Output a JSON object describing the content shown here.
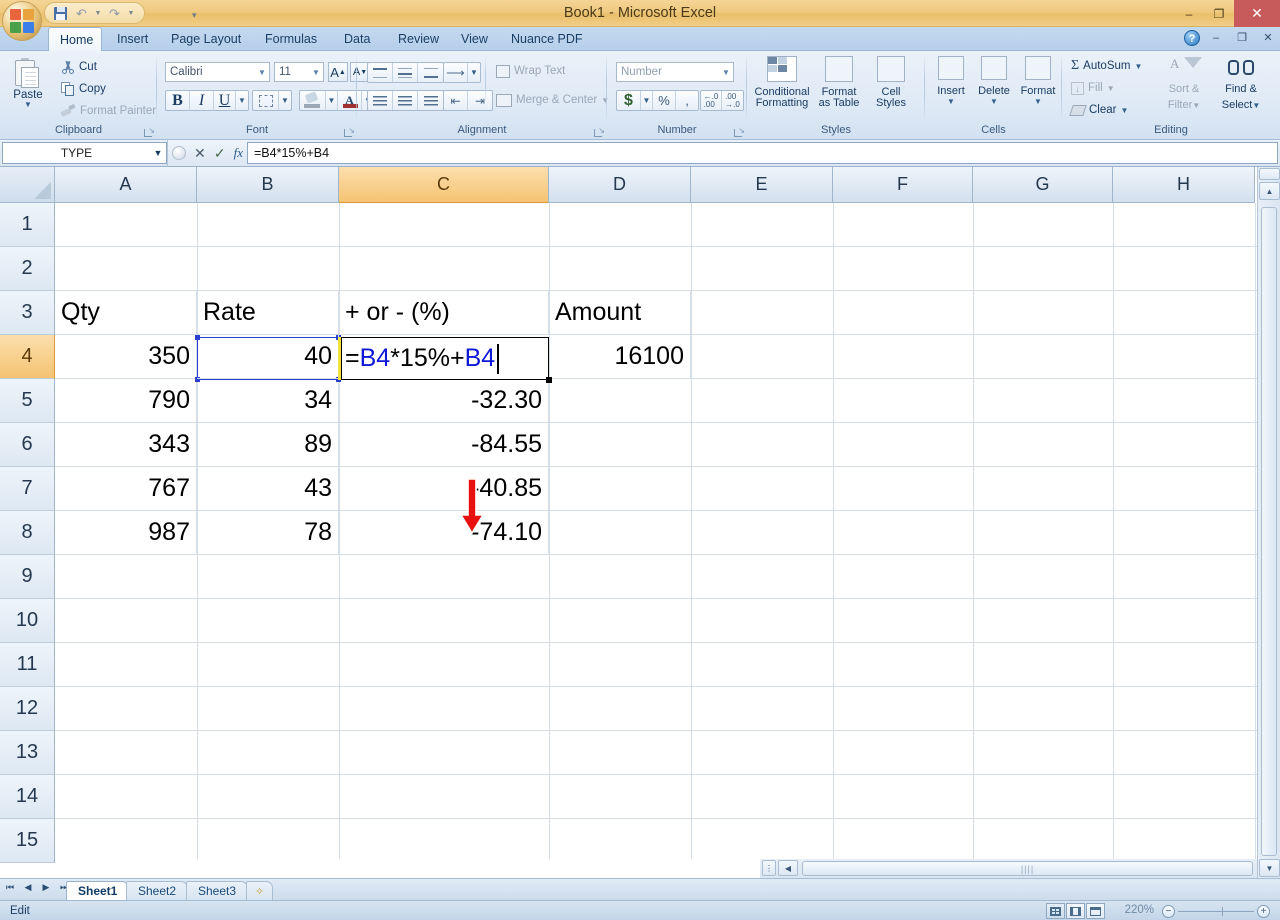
{
  "window": {
    "title": "Book1 - Microsoft Excel",
    "minimize": "–",
    "restore": "❐",
    "close": "✕"
  },
  "quick_access": {
    "save_icon": "save-icon",
    "undo_icon": "undo-icon",
    "redo_icon": "redo-icon",
    "customize_icon": "customize-qat-icon"
  },
  "workbook_controls": {
    "help": "?",
    "minimize": "–",
    "restore": "❐",
    "close": "✕"
  },
  "tabs": [
    {
      "label": "Home",
      "active": true
    },
    {
      "label": "Insert",
      "active": false
    },
    {
      "label": "Page Layout",
      "active": false
    },
    {
      "label": "Formulas",
      "active": false
    },
    {
      "label": "Data",
      "active": false
    },
    {
      "label": "Review",
      "active": false
    },
    {
      "label": "View",
      "active": false
    },
    {
      "label": "Nuance PDF",
      "active": false
    }
  ],
  "ribbon": {
    "clipboard": {
      "label": "Clipboard",
      "paste": "Paste",
      "cut": "Cut",
      "copy": "Copy",
      "format_painter": "Format Painter"
    },
    "font": {
      "label": "Font",
      "font_name": "Calibri",
      "font_size": "11",
      "grow_font": "A",
      "shrink_font": "A",
      "bold": "B",
      "italic": "I",
      "underline": "U"
    },
    "alignment": {
      "label": "Alignment",
      "wrap_text": "Wrap Text",
      "merge_center": "Merge & Center"
    },
    "number": {
      "label": "Number",
      "format": "Number",
      "currency": "$",
      "percent": "%",
      "comma": ",",
      "increase_decimal": ".00",
      "decrease_decimal": ".00"
    },
    "styles": {
      "label": "Styles",
      "conditional_formatting": "Conditional\nFormatting",
      "conditional_formatting_l1": "Conditional",
      "conditional_formatting_l2": "Formatting",
      "format_as_table_l1": "Format",
      "format_as_table_l2": "as Table",
      "cell_styles_l1": "Cell",
      "cell_styles_l2": "Styles"
    },
    "cells": {
      "label": "Cells",
      "insert": "Insert",
      "delete": "Delete",
      "format": "Format"
    },
    "editing": {
      "label": "Editing",
      "autosum": "AutoSum",
      "fill": "Fill",
      "clear": "Clear",
      "sort_filter_l1": "Sort &",
      "sort_filter_l2": "Filter",
      "find_select_l1": "Find &",
      "find_select_l2": "Select",
      "sigma": "Σ"
    }
  },
  "formula_bar": {
    "name_box": "TYPE",
    "cancel_icon": "cancel-icon",
    "enter_icon": "enter-icon",
    "insert_function_icon": "fx",
    "formula": "=B4*15%+B4"
  },
  "grid": {
    "columns": [
      "A",
      "B",
      "C",
      "D",
      "E",
      "F",
      "G",
      "H"
    ],
    "selected_column": "C",
    "rows": [
      "1",
      "2",
      "3",
      "4",
      "5",
      "6",
      "7",
      "8",
      "9",
      "10",
      "11",
      "12",
      "13",
      "14",
      "15"
    ],
    "selected_row": "4",
    "cells": {
      "A3": "Qty",
      "B3": "Rate",
      "C3": "+ or - (%)",
      "D3": "Amount",
      "A4": "350",
      "B4": "40",
      "D4": "16100",
      "A5": "790",
      "B5": "34",
      "C5": "-32.30",
      "A6": "343",
      "B6": "89",
      "C6": "-84.55",
      "A7": "767",
      "B7": "43",
      "C7": "-40.85",
      "A8": "987",
      "B8": "78",
      "C8": "-74.10"
    },
    "editing_cell": {
      "address": "C4",
      "parts": [
        {
          "text": "=",
          "kind": "op"
        },
        {
          "text": "B4",
          "kind": "ref"
        },
        {
          "text": "*15%+",
          "kind": "op"
        },
        {
          "text": "B4",
          "kind": "ref"
        }
      ]
    },
    "reference_highlight": "B4"
  },
  "annotation": {
    "arrow": "red-down-arrow",
    "color": "#e8110f"
  },
  "sheet_tabs": {
    "first_icon": "◀❘",
    "prev_icon": "◀",
    "next_icon": "▶",
    "last_icon": "❙▶",
    "items": [
      {
        "label": "Sheet1",
        "active": true
      },
      {
        "label": "Sheet2",
        "active": false
      },
      {
        "label": "Sheet3",
        "active": false
      }
    ],
    "insert_sheet_icon": "insert-worksheet-icon"
  },
  "status_bar": {
    "mode": "Edit",
    "view_normal": "normal-view-icon",
    "view_page_layout": "page-layout-view-icon",
    "view_page_break": "page-break-preview-icon",
    "zoom": "220%",
    "zoom_out": "−",
    "zoom_in": "+"
  },
  "colors": {
    "title_bar": "#eec97f",
    "tab_strip": "#bdd3ec",
    "selected_header": "#f5c371",
    "formula_ref": "#1018d8",
    "annotation_red": "#e8110f"
  }
}
